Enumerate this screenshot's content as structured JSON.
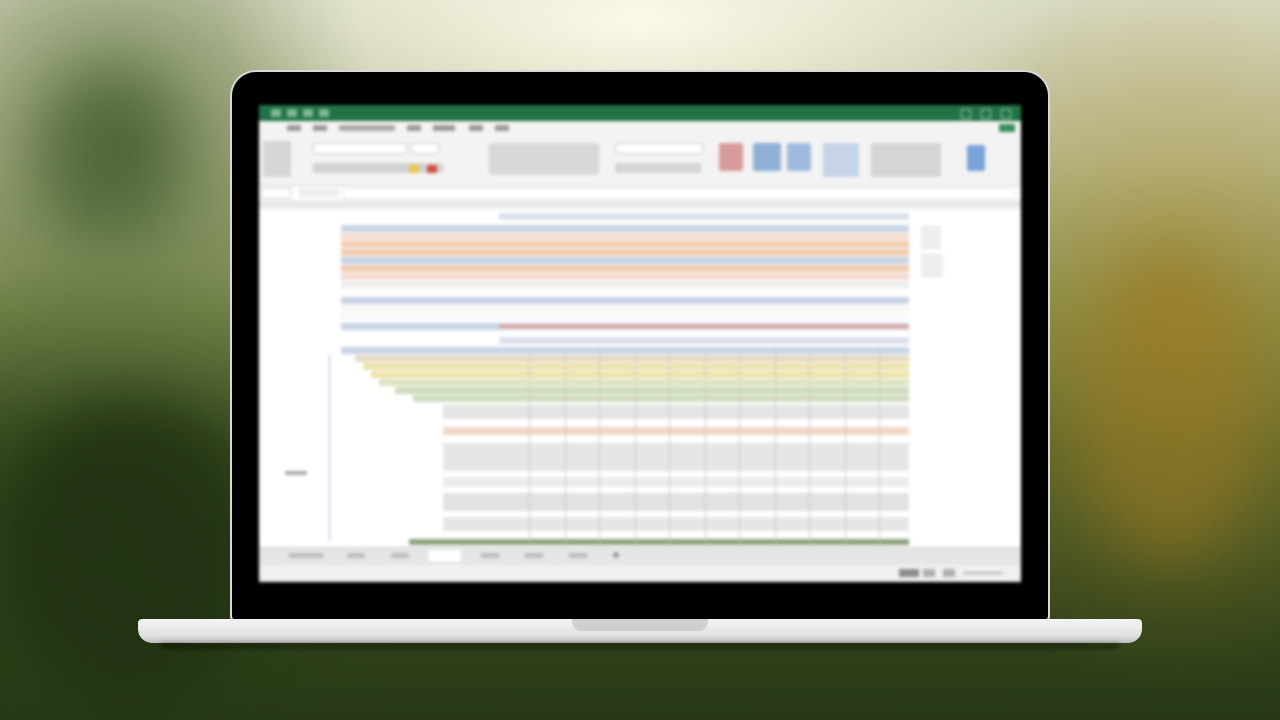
{
  "colors": {
    "excel_green": "#217346",
    "header_blue": "#c8d3e6",
    "band_orange": "#f1cdb4",
    "band_yellow": "#ede3ad",
    "band_green": "#cfdcbd",
    "band_gray": "#dedede"
  },
  "icons": [
    "laptop-frame",
    "excel-window"
  ]
}
